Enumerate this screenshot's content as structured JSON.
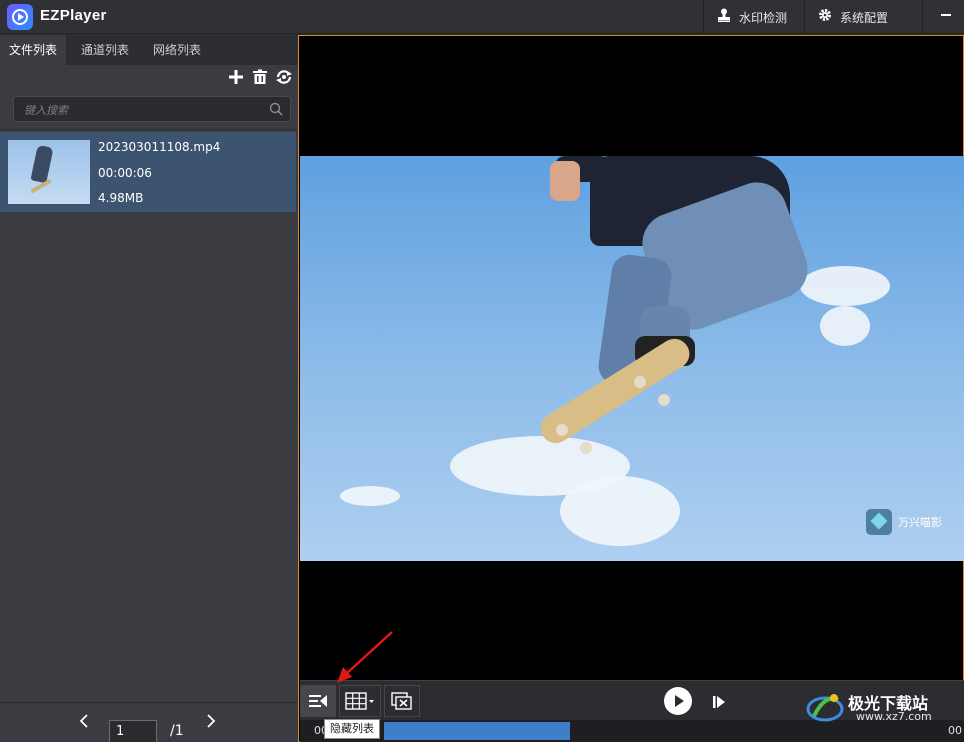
{
  "app": {
    "title": "EZPlayer"
  },
  "titlebar": {
    "watermark_detect_label": "水印检测",
    "settings_label": "系统配置"
  },
  "left_panel": {
    "tabs": [
      {
        "label": "文件列表",
        "active": true
      },
      {
        "label": "通道列表",
        "active": false
      },
      {
        "label": "网络列表",
        "active": false
      }
    ],
    "tools": [
      "add-icon",
      "delete-icon",
      "refresh-icon"
    ],
    "search": {
      "placeholder": "键入搜索"
    },
    "files": [
      {
        "name": "202303011108.mp4",
        "duration": "00:00:06",
        "size": "4.98MB"
      }
    ],
    "pagination": {
      "current": "1",
      "total": "/1"
    }
  },
  "video": {
    "watermark_text": "万兴喵影"
  },
  "controls": {
    "hide_list_tooltip": "隐藏列表",
    "buttons": [
      "hide-list-icon",
      "grid-layout-icon",
      "close-all-icon",
      "play-icon",
      "step-forward-icon"
    ]
  },
  "progress": {
    "current_time": "00:00:03",
    "end_time_partial": "00"
  },
  "site_watermark": {
    "title": "极光下载站",
    "url": "www.xz7.com"
  },
  "colors": {
    "accent_border": "#e08a2a",
    "selection": "#3c5470",
    "progress": "#3f7fc9",
    "arrow": "#e01818"
  }
}
